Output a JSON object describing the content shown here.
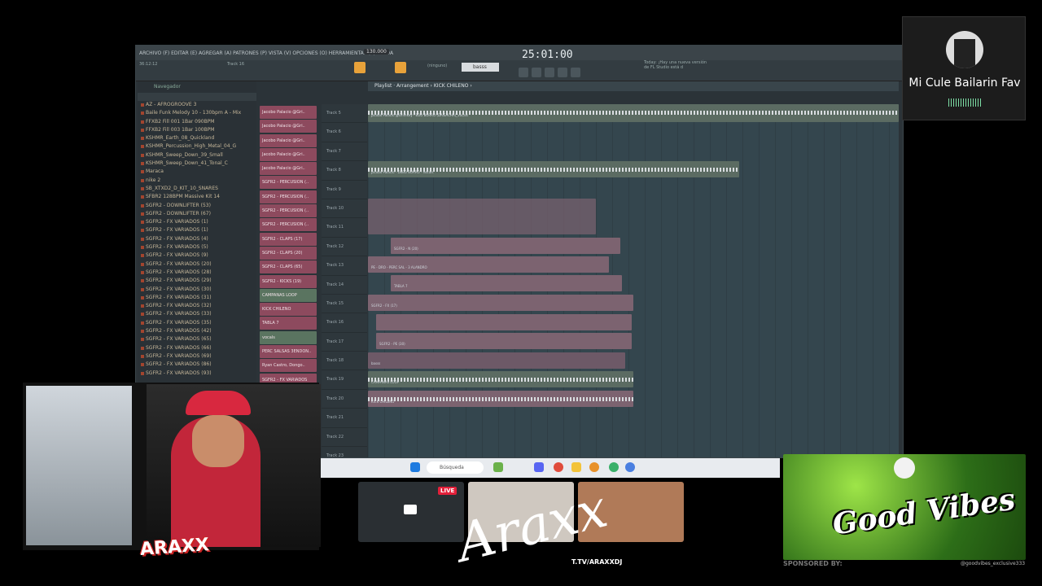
{
  "daw": {
    "menu": "ARCHIVO (F) EDITAR (E) AGREGAR (A) PATRONES (P) VISTA (V) OPCIONES (O) HERRAMIENTAS (T) AYUDA",
    "timer": "25:01:00",
    "tempo": "130.000",
    "pattern": "basss",
    "hint": "Today: ¡Hay una nueva versión de FL Studio está d",
    "position": "36:12:12",
    "track_label": "Track 16",
    "playlist_title": "Playlist · Arrangement › KICK CHILENO ›",
    "mixer_none": "(ninguno)",
    "browser_header": "Navegador",
    "browser": [
      "AZ - AFROGROOVE 3",
      "Baile Funk Melody 10 - 130bpm A - Mix",
      "FFXB2 Fill 001 1Bar 090BPM",
      "FFXB2 Fill 003 1Bar 100BPM",
      "KSHMR_Earth_08_Quickland",
      "KSHMR_Percussion_High_Metal_04_G",
      "KSHMR_Sweep_Down_39_Small",
      "KSHMR_Sweep_Down_41_Tonal_C",
      "Maraca",
      "nike 2",
      "SB_XTXD2_D_KIT_10_SNARES",
      "SFBR2 128BPM Massive Kit 14",
      "SGFR2 - DOWNLIFTER (53)",
      "SGFR2 - DOWNLIFTER (67)",
      "SGFR2 - FX VARIADOS (1)",
      "SGFR2 - FX VARIADOS (1)",
      "SGFR2 - FX VARIADOS (4)",
      "SGFR2 - FX VARIADOS (5)",
      "SGFR2 - FX VARIADOS (9)",
      "SGFR2 - FX VARIADOS (20)",
      "SGFR2 - FX VARIADOS (28)",
      "SGFR2 - FX VARIADOS (29)",
      "SGFR2 - FX VARIADOS (30)",
      "SGFR2 - FX VARIADOS (31)",
      "SGFR2 - FX VARIADOS (32)",
      "SGFR2 - FX VARIADOS (33)",
      "SGFR2 - FX VARIADOS (35)",
      "SGFR2 - FX VARIADOS (42)",
      "SGFR2 - FX VARIADOS (65)",
      "SGFR2 - FX VARIADOS (66)",
      "SGFR2 - FX VARIADOS (69)",
      "SGFR2 - FX VARIADOS (86)",
      "SGFR2 - FX VARIADOS (93)"
    ],
    "channels": [
      "Jacobo Palacio @Gri..",
      "Jacobo Palacio @Gri..",
      "Jacobo Palacio @Gri..",
      "Jacobo Palacio @Gri..",
      "Jacobo Palacio @Gri..",
      "SGFR2 - PERCUSION (..",
      "SGFR2 - PERCUSION (..",
      "SGFR2 - PERCUSION (..",
      "SGFR2 - PERCUSION (..",
      "SGFR2 - CLAPS (17)",
      "SGFR2 - CLAPS (20)",
      "SGFR2 - CLAPS (65)",
      "SGFR2 - KICKS (19)",
      "CAMPANAS LOOP",
      "KICK CHILENO",
      "TABLA 7",
      "vocals",
      "PERC SALSAS 3ENDON..",
      "Ryan Castro, Dongo..",
      "SGFR2 - FX VARIADOS"
    ],
    "tracks": [
      "Track 5",
      "Track 6",
      "Track 7",
      "Track 8",
      "Track 9",
      "Track 10",
      "Track 11",
      "Track 12",
      "Track 13",
      "Track 14",
      "Track 15",
      "Track 16",
      "Track 17",
      "Track 18",
      "Track 19",
      "Track 20",
      "Track 21",
      "Track 22",
      "Track 23"
    ],
    "clips": {
      "vocal1": "Jacobo Palacio @Grimkey - EDO BORRO (DAISACHA)_vocals",
      "vocal2": "Jacobo Palacio @Grimkey - EDO BORRO (DAISACHA)_vocals",
      "vocal3": "Jacobo Palacio - DEBO BORRO - vocals",
      "clap": "SGFR2 - N (20)",
      "perc": "PE - DRO - PERC SAL - 3 ALANDRO",
      "tabla": "TABLA 7",
      "fx": "SGFR2 - FX (17)",
      "fx2": "SGFR2 - PE (30)",
      "bass": "basss",
      "camp": "CAMPANAS LOOP",
      "kick": "KICK CHILENO"
    }
  },
  "overlay": {
    "guest_name": "Mi Cule Bailarin Fav",
    "search": "Búsqueda",
    "live": "LIVE",
    "signature": "Araxx",
    "channel": "T.TV/ARAXXDJ",
    "logo": "ARAXX",
    "gv_text": "Good Vibes",
    "sponsored": "SPONSORED BY:",
    "instagram": "@goodvibes_exclusive333"
  }
}
